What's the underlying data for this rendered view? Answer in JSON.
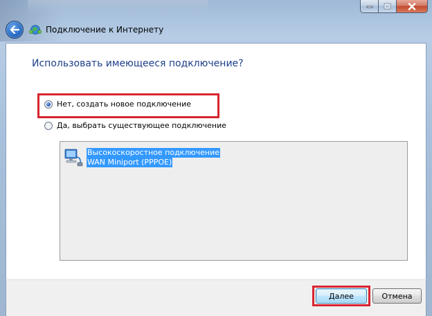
{
  "window": {
    "title": "Подключение к Интернету"
  },
  "caption_buttons": {
    "minimize": "minimize-icon",
    "maximize": "maximize-icon",
    "close": "close-icon"
  },
  "content": {
    "heading": "Использовать имеющееся подключение?",
    "options": [
      {
        "label": "Нет, создать новое подключение",
        "checked": true
      },
      {
        "label": "Да, выбрать существующее подключение",
        "checked": false
      }
    ],
    "connections": [
      {
        "name": "Высокоскоростное подключение",
        "device": "WAN Miniport (PPPOE)",
        "selected": true
      }
    ]
  },
  "footer": {
    "next_label": "Далее",
    "cancel_label": "Отмена"
  },
  "colors": {
    "heading": "#1e3f8a",
    "selection": "#3399ff",
    "highlight": "#d8242f"
  }
}
